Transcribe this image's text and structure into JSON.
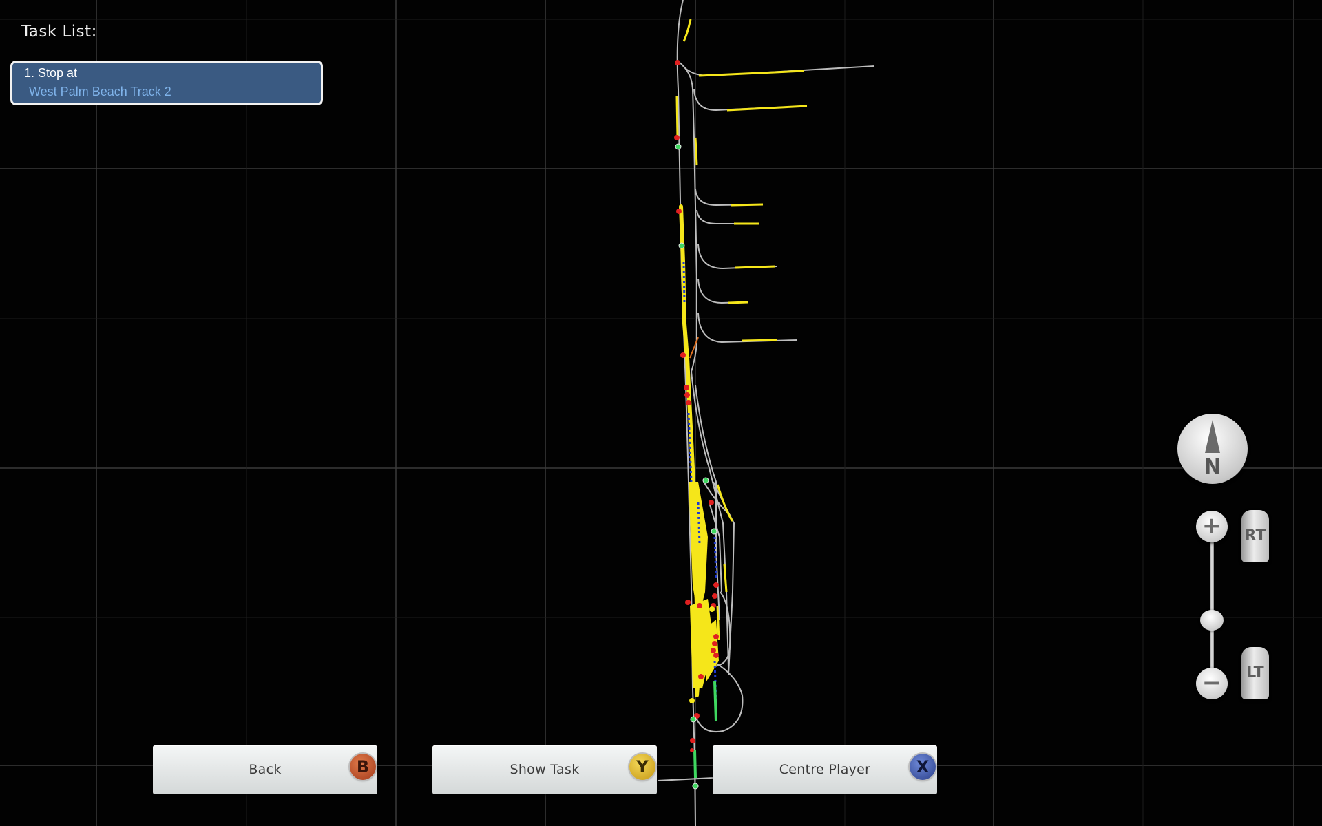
{
  "task_list": {
    "header": "Task List:",
    "items": [
      {
        "title": "1. Stop at",
        "subtitle": "West Palm Beach Track 2"
      }
    ]
  },
  "buttons": {
    "back": {
      "label": "Back",
      "glyph": "B"
    },
    "show_task": {
      "label": "Show Task",
      "glyph": "Y"
    },
    "centre_player": {
      "label": "Centre Player",
      "glyph": "X"
    }
  },
  "compass": {
    "letter": "N"
  },
  "zoom": {
    "plus_symbol": "+",
    "minus_symbol": "−",
    "rt_label": "RT",
    "lt_label": "LT"
  },
  "colors": {
    "background": "#020202",
    "track": "#bdbdbd",
    "route_highlight": "#f5e61a",
    "signal_red": "#e02020",
    "signal_green": "#3fd860",
    "task_card": "#3a5a82",
    "task_subtitle": "#7fb3ea"
  },
  "icons": {
    "compass": "north-compass-icon",
    "back_glyph": "b-controller-button-icon",
    "show_task_glyph": "y-controller-button-icon",
    "centre_player_glyph": "x-controller-button-icon"
  }
}
